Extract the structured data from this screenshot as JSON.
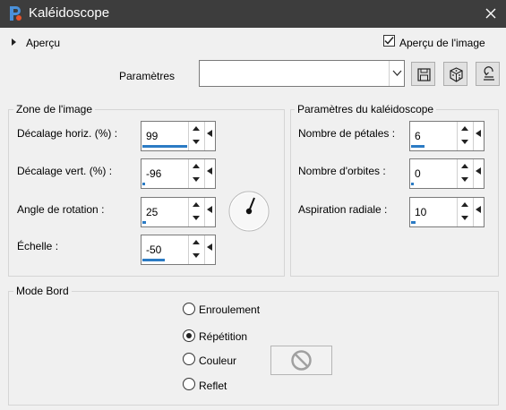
{
  "window": {
    "title": "Kaléidoscope",
    "app_icon": "paintshop-pro-icon",
    "close_icon": "close-icon"
  },
  "top": {
    "preview_toggle_label": "Aperçu",
    "preview_image_label": "Aperçu de l'image",
    "preview_image_checked": true,
    "presets_label": "Paramètres",
    "presets_value": "",
    "buttons": [
      "save-preset-icon",
      "randomize-dice-icon",
      "reset-icon"
    ]
  },
  "image_zone": {
    "legend": "Zone de l'image",
    "horiz_label": "Décalage horiz. (%) :",
    "horiz_value": "99",
    "horiz_level": 0.99,
    "vert_label": "Décalage vert. (%) :",
    "vert_value": "-96",
    "vert_level": 0.02,
    "rotation_label": "Angle de rotation :",
    "rotation_value": "25",
    "rotation_level": 0.07,
    "scale_label": "Échelle :",
    "scale_value": "-50",
    "scale_level": 0.5
  },
  "kaleido": {
    "legend": "Paramètres du kaléidoscope",
    "petals_label": "Nombre de pétales :",
    "petals_value": "6",
    "petals_level": 0.3,
    "orbits_label": "Nombre d'orbites :",
    "orbits_value": "0",
    "orbits_level": 0.0,
    "radial_label": "Aspiration radiale :",
    "radial_value": "10",
    "radial_level": 0.1
  },
  "edge_mode": {
    "legend": "Mode Bord",
    "options": [
      "Enroulement",
      "Répétition",
      "Couleur",
      "Reflet"
    ],
    "selected": "Répétition",
    "color_icon": "no-entry-icon"
  },
  "colors": {
    "titlebar": "#3d3d3d",
    "accent": "#2b7bc4"
  }
}
